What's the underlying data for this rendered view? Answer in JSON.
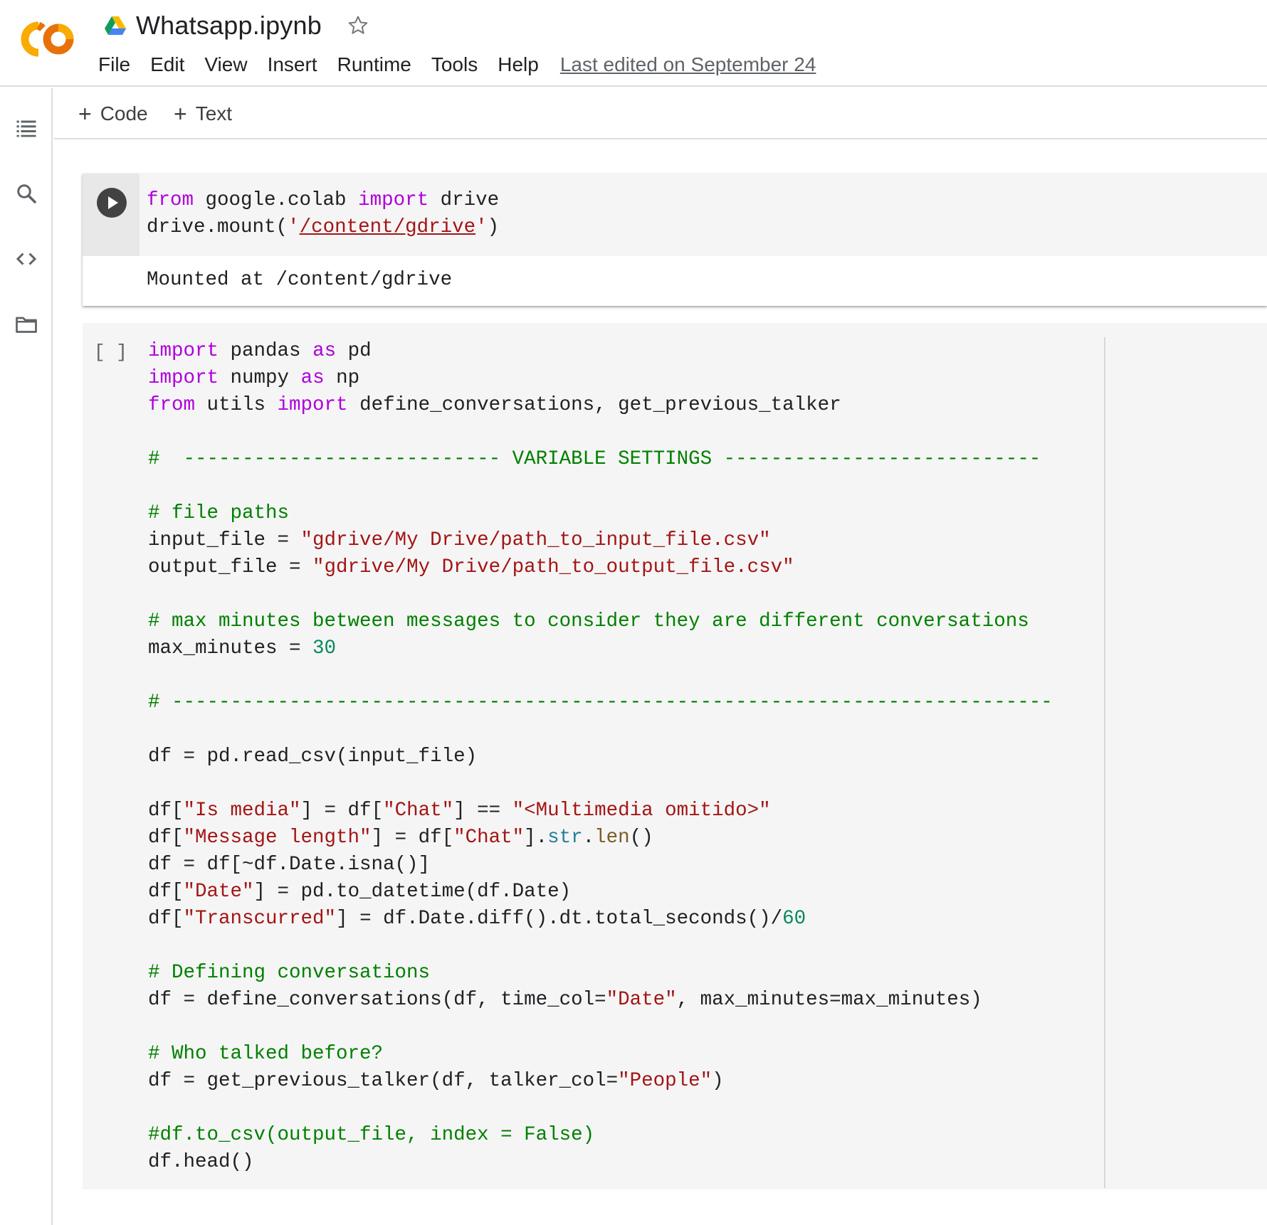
{
  "header": {
    "title": "Whatsapp.ipynb",
    "menu": [
      "File",
      "Edit",
      "View",
      "Insert",
      "Runtime",
      "Tools",
      "Help"
    ],
    "last_edited": "Last edited on September 24"
  },
  "toolbar": {
    "add_code": "Code",
    "add_text": "Text"
  },
  "sidebar": {
    "icons": [
      "table-of-contents-icon",
      "search-icon",
      "code-snippets-icon",
      "files-folder-icon"
    ]
  },
  "cells": [
    {
      "type": "code",
      "executed": true,
      "code_lines": [
        "from google.colab import drive",
        "drive.mount('/content/gdrive')"
      ],
      "output": "Mounted at /content/gdrive"
    },
    {
      "type": "code",
      "executed": false,
      "execution_label": "[ ]",
      "code_lines": [
        "import pandas as pd",
        "import numpy as np",
        "from utils import define_conversations, get_previous_talker",
        "",
        "#  --------------------------- VARIABLE SETTINGS ---------------------------",
        "",
        "# file paths",
        "input_file = \"gdrive/My Drive/path_to_input_file.csv\"",
        "output_file = \"gdrive/My Drive/path_to_output_file.csv\"",
        "",
        "# max minutes between messages to consider they are different conversations",
        "max_minutes = 30",
        "",
        "# ---------------------------------------------------------------------------",
        "",
        "df = pd.read_csv(input_file)",
        "",
        "df[\"Is media\"] = df[\"Chat\"] == \"<Multimedia omitido>\"",
        "df[\"Message length\"] = df[\"Chat\"].str.len()",
        "df = df[~df.Date.isna()]",
        "df[\"Date\"] = pd.to_datetime(df.Date)",
        "df[\"Transcurred\"] = df.Date.diff().dt.total_seconds()/60",
        "",
        "# Defining conversations",
        "df = define_conversations(df, time_col=\"Date\", max_minutes=max_minutes)",
        "",
        "# Who talked before?",
        "df = get_previous_talker(df, talker_col=\"People\")",
        "",
        "#df.to_csv(output_file, index = False)",
        "df.head()"
      ]
    }
  ],
  "colors": {
    "keyword": "#af00db",
    "string": "#a31515",
    "comment": "#008000",
    "number": "#09885a",
    "builtin": "#267f99",
    "function": "#795e26",
    "logo_orange": "#f9ab00",
    "logo_dark_orange": "#e8710a"
  }
}
